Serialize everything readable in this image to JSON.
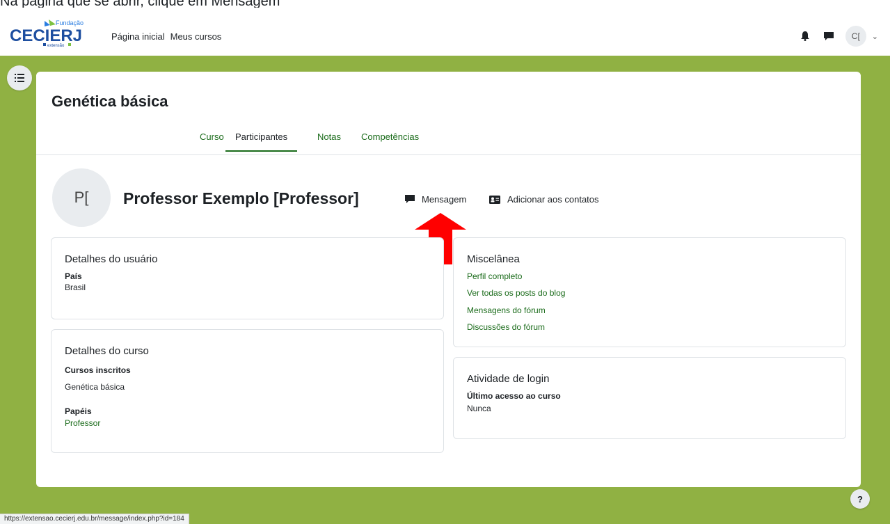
{
  "top_text": "Na página que se abrir, clique em Mensagem",
  "navbar": {
    "logo": {
      "small": "Fundação",
      "name": "CECIERJ",
      "tag": "extensão"
    },
    "links": [
      "Página inicial",
      "Meus cursos"
    ],
    "avatar_initials": "C[",
    "icons": [
      "bell-icon",
      "chat-icon",
      "chevron-down-icon"
    ]
  },
  "course": {
    "title": "Genética básica",
    "tabs": [
      "Curso",
      "Participantes",
      "Notas",
      "Competências"
    ],
    "active_tab": "Participantes"
  },
  "profile": {
    "initials": "P[",
    "name": "Professor Exemplo [Professor]",
    "message_label": "Mensagem",
    "add_contact_label": "Adicionar aos contatos"
  },
  "user_details": {
    "heading": "Detalhes do usuário",
    "country_label": "País",
    "country_value": "Brasil"
  },
  "course_details": {
    "heading": "Detalhes do curso",
    "enrolled_label": "Cursos inscritos",
    "enrolled_value": "Genética básica",
    "roles_label": "Papéis",
    "roles_value": "Professor"
  },
  "misc": {
    "heading": "Miscelânea",
    "links": [
      "Perfil completo",
      "Ver todas os posts do blog",
      "Mensagens do fórum",
      "Discussões do fórum"
    ]
  },
  "login_activity": {
    "heading": "Atividade de login",
    "last_access_label": "Último acesso ao curso",
    "last_access_value": "Nunca"
  },
  "help_label": "?",
  "status_url": "https://extensao.cecierj.edu.br/message/index.php?id=184",
  "colors": {
    "accent": "#1a6b1a",
    "page_bg": "#90b143",
    "arrow": "#ff0000"
  }
}
